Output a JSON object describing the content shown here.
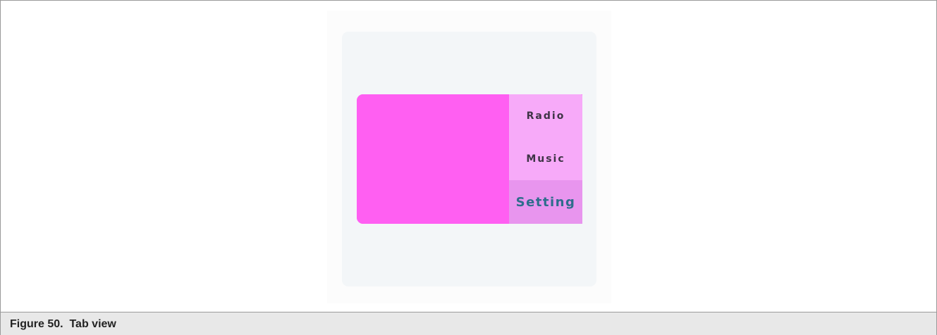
{
  "figure": {
    "caption": "Figure 50.  Tab view"
  },
  "tabview": {
    "tabs": [
      {
        "label": "Radio",
        "selected": false
      },
      {
        "label": "Music",
        "selected": false
      },
      {
        "label": "Setting",
        "selected": true
      }
    ],
    "colors": {
      "content": "#ff5ff2",
      "tab_bar": "#f7aaf9",
      "selected_tab": "#e895ee",
      "selected_text": "#2e6d8c",
      "tab_text": "#3e3446",
      "screen_bg": "#f3f6f8"
    }
  }
}
